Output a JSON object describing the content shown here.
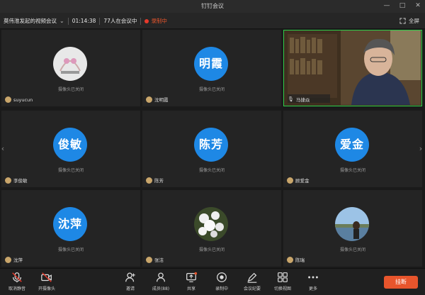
{
  "window": {
    "title": "钉钉会议"
  },
  "infobar": {
    "meeting_name": "莫伟淮发起的视频会议",
    "duration": "01:14:38",
    "participants_online": "77人在会议中",
    "recording_label": "录制中",
    "fullscreen_label": "全屏"
  },
  "colors": {
    "accent": "#1e88e5",
    "active_speaker": "#2ecf4a",
    "end_button": "#e8552c"
  },
  "tiles": [
    {
      "name": "suyucun",
      "status": "摄像头已关闭",
      "avatar_type": "photo"
    },
    {
      "name": "沈明霞",
      "avatar_text": "明霞",
      "status": "摄像头已关闭"
    },
    {
      "name": "马捷焱",
      "avatar_type": "video"
    },
    {
      "name": "李俊敏",
      "avatar_text": "俊敏",
      "status": "摄像头已关闭"
    },
    {
      "name": "陈芳",
      "avatar_text": "陈芳",
      "status": "摄像头已关闭"
    },
    {
      "name": "顾爱金",
      "avatar_text": "爱金",
      "status": "摄像头已关闭"
    },
    {
      "name": "沈萍",
      "avatar_text": "沈萍",
      "status": "摄像头已关闭"
    },
    {
      "name": "张洁",
      "status": "摄像头已关闭",
      "avatar_type": "photo"
    },
    {
      "name": "陈瑞",
      "status": "摄像头已关闭",
      "avatar_type": "photo"
    }
  ],
  "toolbar": {
    "mute_label": "取消静音",
    "camera_label": "开摄像头",
    "invite_label": "邀请",
    "members_label": "成员(88)",
    "share_label": "共享",
    "record_label": "录制中",
    "minutes_label": "会议纪要",
    "switch_view_label": "切换视图",
    "more_label": "更多",
    "end_label": "挂断"
  }
}
